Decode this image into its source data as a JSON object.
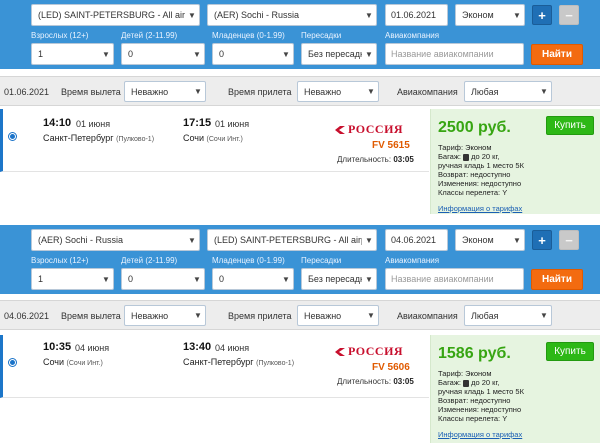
{
  "segments": [
    {
      "search": {
        "from": "(LED) SAINT-PETERSBURG - All airp",
        "to": "(AER) Sochi - Russia",
        "date": "01.06.2021",
        "class": "Эконом",
        "plus": "+",
        "minus": "−",
        "adults_label": "Взрослых (12+)",
        "adults_value": "1",
        "children_label": "Детей (2-11.99)",
        "children_value": "0",
        "infants_label": "Младенцев (0-1.99)",
        "infants_value": "0",
        "transfers_label": "Пересадки",
        "transfers_value": "Без пересадки",
        "airline_label": "Авиакомпания",
        "airline_placeholder": "Название авиакомпании",
        "find": "Найти"
      },
      "filter": {
        "date": "01.06.2021",
        "dep_label": "Время вылета",
        "dep_value": "Неважно",
        "arr_label": "Время прилета",
        "arr_value": "Неважно",
        "airline_label": "Авиакомпания",
        "airline_value": "Любая"
      },
      "result": {
        "dep_time": "14:10",
        "dep_date": "01 июня",
        "dep_city": "Санкт-Петербург",
        "dep_airport": "(Пулково-1)",
        "arr_time": "17:15",
        "arr_date": "01 июня",
        "arr_city": "Сочи",
        "arr_airport": "(Сочи Инт.)",
        "airline": "РОССИЯ",
        "flight": "FV 5615",
        "duration_label": "Длительность:",
        "duration": "03:05",
        "price": "2500 руб.",
        "buy": "Купить",
        "tariff": "Тариф: Эконом",
        "baggage_prefix": "Багаж:",
        "baggage_suffix": "до 20 кг,",
        "hand": "ручная кладь 1 место 5К",
        "refund": "Возврат: недоступно",
        "changes": "Изменения: недоступно",
        "classes": "Классы перелета: Y",
        "tariff_link": "Информация о тарифах"
      }
    },
    {
      "search": {
        "from": "(AER) Sochi - Russia",
        "to": "(LED) SAINT-PETERSBURG - All airp",
        "date": "04.06.2021",
        "class": "Эконом",
        "plus": "+",
        "minus": "−",
        "adults_label": "Взрослых (12+)",
        "adults_value": "1",
        "children_label": "Детей (2-11.99)",
        "children_value": "0",
        "infants_label": "Младенцев (0-1.99)",
        "infants_value": "0",
        "transfers_label": "Пересадки",
        "transfers_value": "Без пересадки",
        "airline_label": "Авиакомпания",
        "airline_placeholder": "Название авиакомпании",
        "find": "Найти"
      },
      "filter": {
        "date": "04.06.2021",
        "dep_label": "Время вылета",
        "dep_value": "Неважно",
        "arr_label": "Время прилета",
        "arr_value": "Неважно",
        "airline_label": "Авиакомпания",
        "airline_value": "Любая"
      },
      "result": {
        "dep_time": "10:35",
        "dep_date": "04 июня",
        "dep_city": "Сочи",
        "dep_airport": "(Сочи Инт.)",
        "arr_time": "13:40",
        "arr_date": "04 июня",
        "arr_city": "Санкт-Петербург",
        "arr_airport": "(Пулково-1)",
        "airline": "РОССИЯ",
        "flight": "FV 5606",
        "duration_label": "Длительность:",
        "duration": "03:05",
        "price": "1586 руб.",
        "buy": "Купить",
        "tariff": "Тариф: Эконом",
        "baggage_prefix": "Багаж:",
        "baggage_suffix": "до 20 кг,",
        "hand": "ручная кладь 1 место 5К",
        "refund": "Возврат: недоступно",
        "changes": "Изменения: недоступно",
        "classes": "Классы перелета: Y",
        "tariff_link": "Информация о тарифах"
      }
    }
  ],
  "colors": {
    "search_bg": "#3a93d6",
    "find_button": "#f36b10",
    "buy_button": "#2db816",
    "price": "#37a512",
    "airline_red": "#c8102e"
  },
  "icons": [
    "caret-down-icon",
    "radio-selected-icon",
    "rossiya-wing-icon",
    "baggage-icon"
  ]
}
